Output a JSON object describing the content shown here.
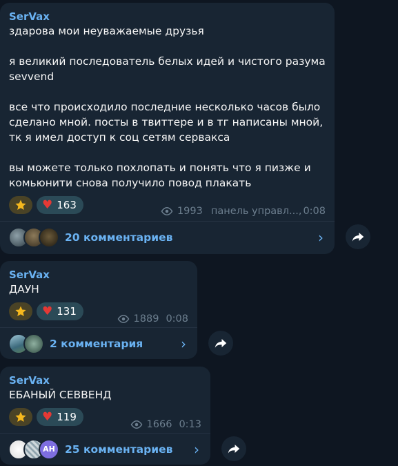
{
  "messages": [
    {
      "author": "SerVax",
      "text": "здарова мои неуважаемые друзья\n\nя великий последователь белых идей и чистого разума sevvend\n\nвсе что происходило последние несколько часов было сделано мной. посты в твиттере и в тг написаны мной, тк я имел доступ к соц сетям сервакса\n\nвы можете только похлопать и понять что я пизже и комьюнити снова получило повод плакать",
      "reaction_heart_count": "163",
      "views": "1993",
      "signature": "панель управл...,",
      "time": "0:08",
      "comments_label": "20 комментариев"
    },
    {
      "author": "SerVax",
      "text": "ДАУН",
      "reaction_heart_count": "131",
      "views": "1889",
      "time": "0:08",
      "comments_label": "2 комментария"
    },
    {
      "author": "SerVax",
      "text": "ЕБАНЫЙ СЕВВЕНД",
      "reaction_heart_count": "119",
      "views": "1666",
      "time": "0:13",
      "comments_label": "25 комментариев",
      "avatar_initials": "AH"
    }
  ],
  "icons": {
    "star": "star-icon",
    "heart": "heart-icon",
    "eye": "eye-icon",
    "chevron": "chevron-right-icon",
    "share": "share-arrow-icon"
  },
  "colors": {
    "background": "#0e1621",
    "bubble": "#182533",
    "accent": "#6ab2f2",
    "heart": "#e53935"
  }
}
